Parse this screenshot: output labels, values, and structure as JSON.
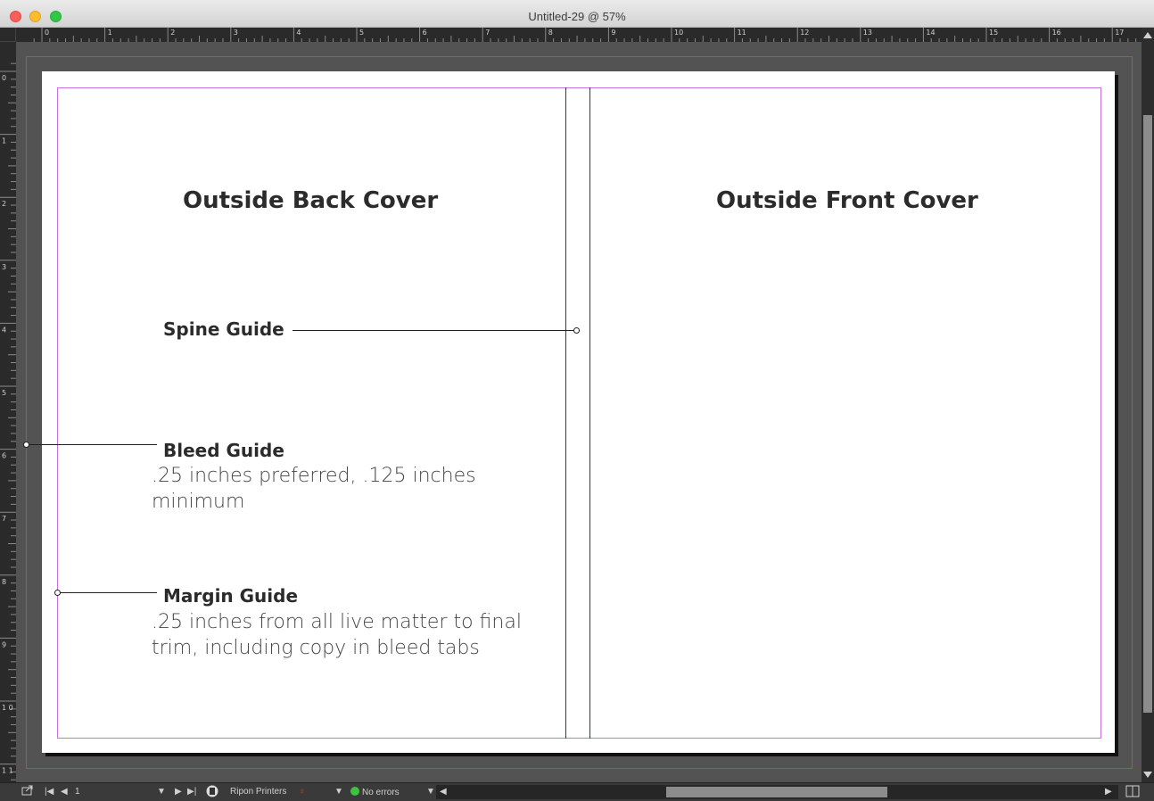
{
  "window": {
    "title": "Untitled-29 @ 57%"
  },
  "rulers": {
    "horizontal": [
      "0",
      "1",
      "2",
      "3",
      "4",
      "5",
      "6",
      "7",
      "8",
      "9",
      "10",
      "11",
      "12",
      "13",
      "14",
      "15",
      "16",
      "17"
    ],
    "vertical": [
      "0",
      "1",
      "2",
      "3",
      "4",
      "5",
      "6",
      "7",
      "8",
      "9",
      "1 0",
      "1 1"
    ]
  },
  "document": {
    "back_cover_heading": "Outside Back Cover",
    "front_cover_heading": "Outside Front Cover",
    "spine_label": "Spine Guide",
    "bleed_label": "Bleed Guide",
    "bleed_desc": ".25 inches preferred, .125 inches minimum",
    "margin_label": "Margin Guide",
    "margin_desc": ".25 inches from all live matter to final trim, including copy in bleed tabs",
    "colors": {
      "bleed_guide": "#e5393e",
      "margin_guide": "#c96fe6",
      "pasteboard": "#535353"
    }
  },
  "statusbar": {
    "page_number": "1",
    "preflight_profile": "Ripon Printers",
    "errors": "No errors"
  },
  "icons": [
    "share-icon",
    "first-page-icon",
    "prev-page-icon",
    "next-page-icon",
    "last-page-icon",
    "page-options-icon",
    "preflight-status-icon",
    "scroll-left-icon",
    "scroll-right-icon",
    "split-view-icon"
  ]
}
